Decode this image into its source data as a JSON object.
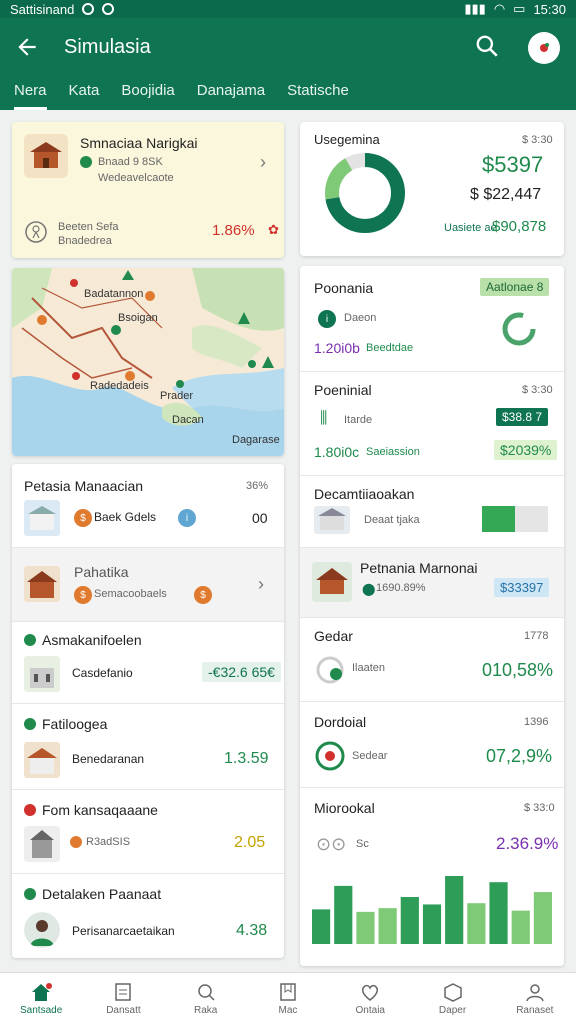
{
  "status": {
    "carrier": "Sattisinand",
    "time": "15:30"
  },
  "appbar": {
    "title": "Simulasia"
  },
  "tabs": [
    {
      "label": "Nera",
      "active": true
    },
    {
      "label": "Kata",
      "active": false
    },
    {
      "label": "Boojidia",
      "active": false
    },
    {
      "label": "Danajama",
      "active": false
    },
    {
      "label": "Statische",
      "active": false
    }
  ],
  "left": {
    "hero": {
      "title": "Smnaciaa Narigkai",
      "meta_line1": "Bnaad 9 8SK",
      "meta_line2": "Wedeavelcaote",
      "foot_line1": "Beeten Sefa",
      "foot_line2": "Bnadedrea",
      "value": "1.86%"
    },
    "map": {
      "labels": [
        "Badatannon",
        "Bsoigan",
        "Radedadeis",
        "Prader",
        "Dacan",
        "Dagarase"
      ]
    },
    "list_header": {
      "title": "Petasia Manaacian",
      "value": "36%"
    },
    "rows": [
      {
        "title": "",
        "sub": "Baek Gdels",
        "value": "00"
      },
      {
        "title": "Pahatika",
        "sub": "Semacoobaels",
        "value": ""
      },
      {
        "title": "Asmakanifoelen",
        "sub": "Casdefanio",
        "value": "-€32.6 65€"
      },
      {
        "title": "Fatiloogea",
        "sub": "Benedaranan",
        "value": "1.3.59"
      },
      {
        "title": "Fom kansaqaaane",
        "sub": "R3adSIS",
        "value": "2.05"
      },
      {
        "title": "Detalaken Paanaat",
        "sub": "Perisanarcaetaikan",
        "value": "4.38"
      }
    ]
  },
  "right": {
    "summary": {
      "title": "Usegemina",
      "corner": "$ 3:30",
      "big": "$5397",
      "mid": "$ $22,447",
      "foot_label": "Uasiete ae",
      "foot_value": "$90,878"
    },
    "cards": [
      {
        "title": "Poonania",
        "badge": "Aatlonae 8",
        "sub": "Daeon",
        "value": "1.20i0b",
        "value_label": "Beedtdae"
      },
      {
        "title": "Poeninial",
        "corner": "$ 3:30",
        "sub": "Itarde",
        "chip": "$38.8 7",
        "value": "1.80i0c",
        "value_label": "Saeiassion",
        "chip2": "$2039%"
      },
      {
        "title": "Decamtiiaoakan",
        "sub": "Deaat tjaka"
      },
      {
        "title": "Petnania Marnonai",
        "sub": "1690.89%",
        "chip": "$33397"
      },
      {
        "title": "Gedar",
        "corner": "1778",
        "sub": "Ilaaten",
        "value": "010,58%"
      },
      {
        "title": "Dordoial",
        "corner": "1396",
        "sub": "Sedear",
        "value": "07,2,9%"
      },
      {
        "title": "Miorookal",
        "corner": "$ 33:0",
        "sub": "Sc",
        "value": "2.36.9%"
      }
    ]
  },
  "chart_data": {
    "type": "bar",
    "values": [
      28,
      47,
      26,
      29,
      38,
      32,
      55,
      33,
      50,
      27,
      42
    ],
    "colors": [
      "#2e9d57",
      "#2e9d57",
      "#7fca76",
      "#7fca76",
      "#2e9d57",
      "#2e9d57",
      "#2e9d57",
      "#7fca76",
      "#2e9d57",
      "#7fca76",
      "#7fca76"
    ]
  },
  "bottomnav": [
    {
      "label": "Santsade",
      "active": true
    },
    {
      "label": "Dansatt",
      "active": false
    },
    {
      "label": "Raka",
      "active": false
    },
    {
      "label": "Mac",
      "active": false
    },
    {
      "label": "Ontaia",
      "active": false
    },
    {
      "label": "Daper",
      "active": false
    },
    {
      "label": "Ranaset",
      "active": false
    }
  ],
  "colors": {
    "brand": "#0f7452",
    "accent_green": "#1f8a4c",
    "accent_red": "#d0312d",
    "accent_purple": "#7a2fb0",
    "accent_yellow": "#c4a200"
  }
}
